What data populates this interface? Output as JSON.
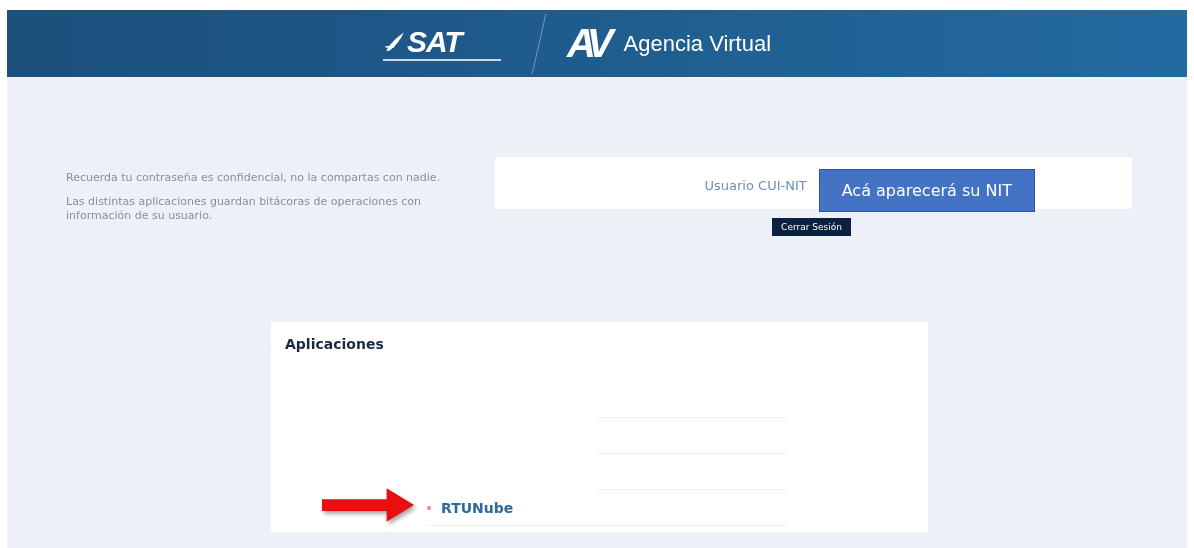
{
  "header": {
    "brand": "SAT",
    "logo_mark": "AV",
    "title": "Agencia Virtual"
  },
  "notices": [
    "Recuerda tu contraseña es confidencial, no la compartas con nadie.",
    "Las distintas aplicaciones guardan bitácoras de operaciones con información de su usuario."
  ],
  "user_panel": {
    "label": "Usuario CUI-NIT",
    "callout": "Acá aparecerá su NIT",
    "logout_button": "Cerrar Sesión"
  },
  "applications": {
    "title": "Aplicaciones",
    "items": [
      {
        "label": "RTUNube",
        "highlighted": true
      }
    ]
  }
}
